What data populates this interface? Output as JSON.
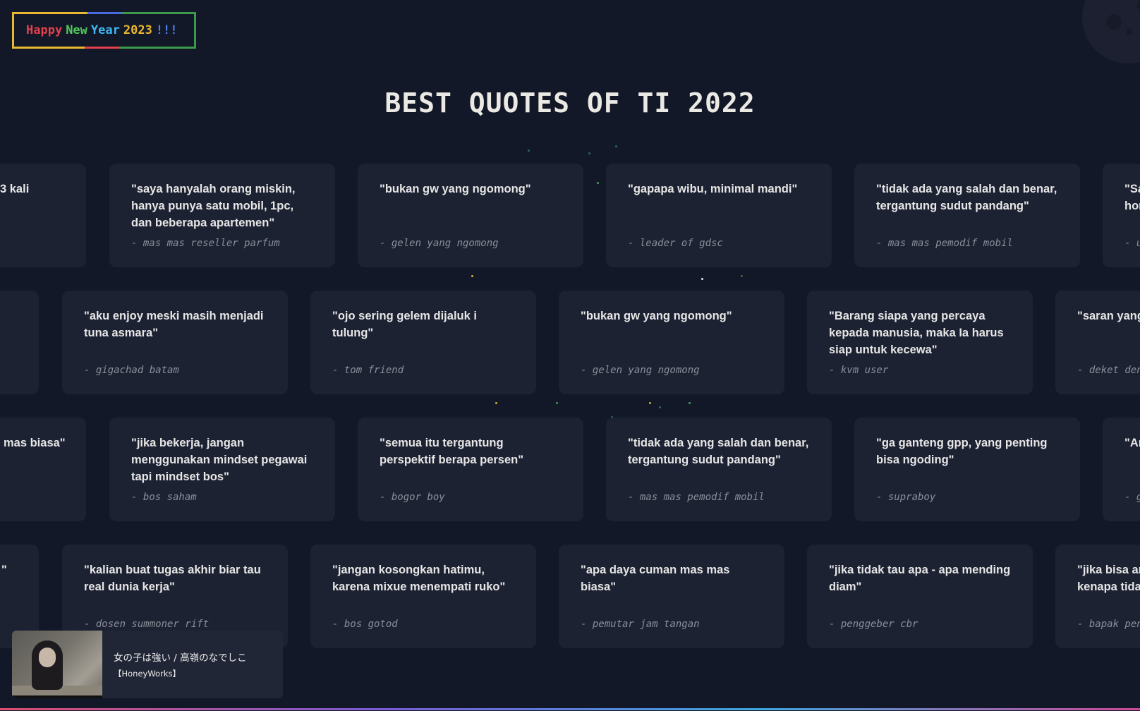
{
  "banner": {
    "words": [
      {
        "text": "Happy",
        "color": "#e2414c"
      },
      {
        "text": "New",
        "color": "#52c75a"
      },
      {
        "text": "Year",
        "color": "#3fb6f0"
      },
      {
        "text": "2023",
        "color": "#e8b830"
      },
      {
        "text": "!!!",
        "color": "#4a80f0"
      }
    ]
  },
  "title": "BEST QUOTES OF TI 2022",
  "rows": [
    {
      "cards": [
        {
          "quote": "3 kali",
          "author": ""
        },
        {
          "quote": "\"saya hanyalah orang miskin, hanya punya satu mobil, 1pc, dan beberapa apartemen\"",
          "author": "- mas mas reseller parfum"
        },
        {
          "quote": "\"bukan gw yang ngomong\"",
          "author": "- gelen yang ngomong"
        },
        {
          "quote": "\"gapapa wibu, minimal mandi\"",
          "author": "- leader of gdsc"
        },
        {
          "quote": "\"tidak ada yang salah dan benar, tergantung sudut pandang\"",
          "author": "- mas mas pemodif mobil"
        },
        {
          "quote": "\"Sa hor",
          "author": "- u"
        }
      ]
    },
    {
      "cards": [
        {
          "quote": "",
          "author": ""
        },
        {
          "quote": "\"aku enjoy meski masih menjadi tuna asmara\"",
          "author": "- gigachad batam"
        },
        {
          "quote": "\"ojo sering gelem dijaluk i tulung\"",
          "author": "- tom friend"
        },
        {
          "quote": "\"bukan gw yang ngomong\"",
          "author": "- gelen yang ngomong"
        },
        {
          "quote": "\"Barang siapa yang percaya kepada manusia, maka Ia harus siap untuk kecewa\"",
          "author": "- kvm user"
        },
        {
          "quote": "\"saran yang lokal\"",
          "author": "- deket den"
        }
      ]
    },
    {
      "cards": [
        {
          "quote": "mas biasa\"",
          "author": ""
        },
        {
          "quote": "\"jika bekerja, jangan menggunakan mindset pegawai tapi mindset bos\"",
          "author": "- bos saham"
        },
        {
          "quote": "\"semua itu tergantung perspektif berapa persen\"",
          "author": "- bogor boy"
        },
        {
          "quote": "\"tidak ada yang salah dan benar, tergantung sudut pandang\"",
          "author": "- mas mas pemodif mobil"
        },
        {
          "quote": "\"ga ganteng gpp, yang penting bisa ngoding\"",
          "author": "- supraboy"
        },
        {
          "quote": "\"An",
          "author": "- g"
        }
      ]
    },
    {
      "cards": [
        {
          "quote": "\"",
          "author": ""
        },
        {
          "quote": "\"kalian buat tugas akhir biar tau real dunia kerja\"",
          "author": "- dosen summoner rift"
        },
        {
          "quote": "\"jangan kosongkan hatimu, karena mixue menempati ruko\"",
          "author": "- bos gotod"
        },
        {
          "quote": "\"apa daya cuman mas mas biasa\"",
          "author": "- pemutar jam tangan"
        },
        {
          "quote": "\"jika tidak tau apa - apa mending diam\"",
          "author": "- penggeber cbr"
        },
        {
          "quote": "\"jika bisa ar kenapa tidal",
          "author": "- bapak pen"
        }
      ]
    }
  ],
  "player": {
    "title": "女の子は強い / 高嶺のなでしこ",
    "artist": "【HoneyWorks】"
  }
}
